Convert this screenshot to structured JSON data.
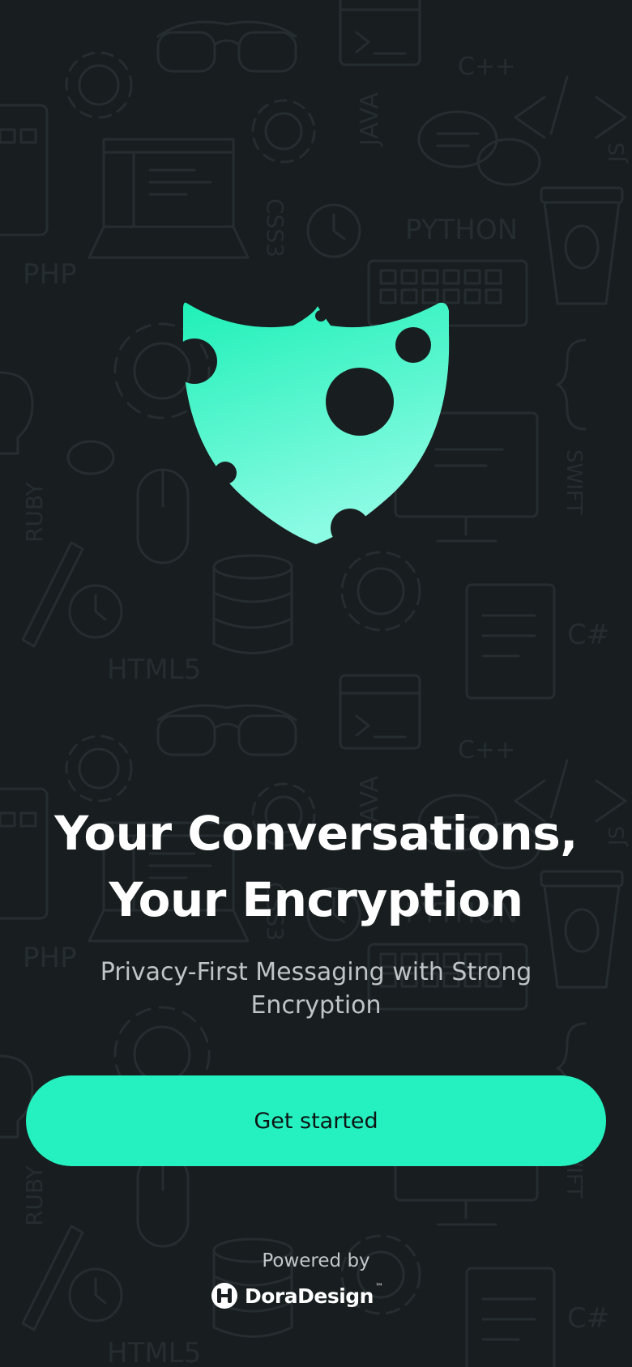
{
  "onboarding": {
    "headline_line1": "Your Conversations,",
    "headline_line2": "Your Encryption",
    "subtitle": "Privacy-First Messaging with Strong Encryption",
    "cta_label": "Get started"
  },
  "footer": {
    "powered_by": "Powered by",
    "brand_name": "DoraDesign",
    "brand_trademark": "™"
  },
  "icons": {
    "hero": "shield-icon",
    "brand": "doradesign-logo-icon",
    "background": "developer-doodle-pattern"
  },
  "colors": {
    "background": "#181d1f",
    "accent": "#24f1bf",
    "shield_top": "#1ff0b8",
    "shield_bottom": "#8afbe2",
    "text_primary": "#ffffff",
    "text_secondary": "#bfc4c6"
  }
}
